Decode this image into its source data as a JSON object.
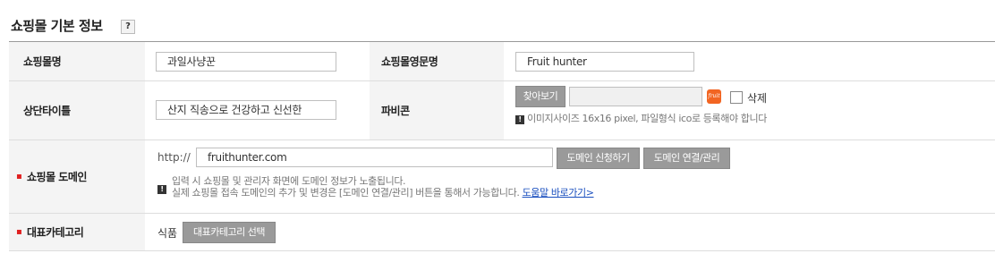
{
  "section": {
    "title": "쇼핑몰 기본 정보",
    "help": "?"
  },
  "rows": {
    "mall_name": {
      "label": "쇼핑몰명",
      "value": "과일사냥꾼"
    },
    "mall_name_en": {
      "label": "쇼핑몰영문명",
      "value": "Fruit hunter"
    },
    "top_title": {
      "label": "상단타이틀",
      "value": "산지 직송으로 건강하고 신선한"
    },
    "favicon": {
      "label": "파비콘",
      "browse_button": "찾아보기",
      "file_value": "",
      "icon_text": "fruit",
      "delete_label": "삭제",
      "note": "이미지사이즈 16x16 pixel, 파일형식 ico로 등록해야 합니다"
    },
    "domain": {
      "required_mark": "▪",
      "label": "쇼핑몰 도메인",
      "prefix": "http://",
      "value": "fruithunter.com",
      "apply_button": "도메인 신청하기",
      "manage_button": "도메인 연결/관리",
      "note_line1": "입력 시 쇼핑몰 및 관리자 화면에 도메인 정보가 노출됩니다.",
      "note_line2": "실제 쇼핑몰 접속 도메인의 추가 및 변경은 [도메인 연결/관리] 버튼을 통해서 가능합니다.",
      "help_link": "도움말 바로가기>"
    },
    "category": {
      "required_mark": "▪",
      "label": "대표카테고리",
      "value": "식품",
      "select_button": "대표카테고리 선택"
    }
  },
  "icon_mark": "!"
}
